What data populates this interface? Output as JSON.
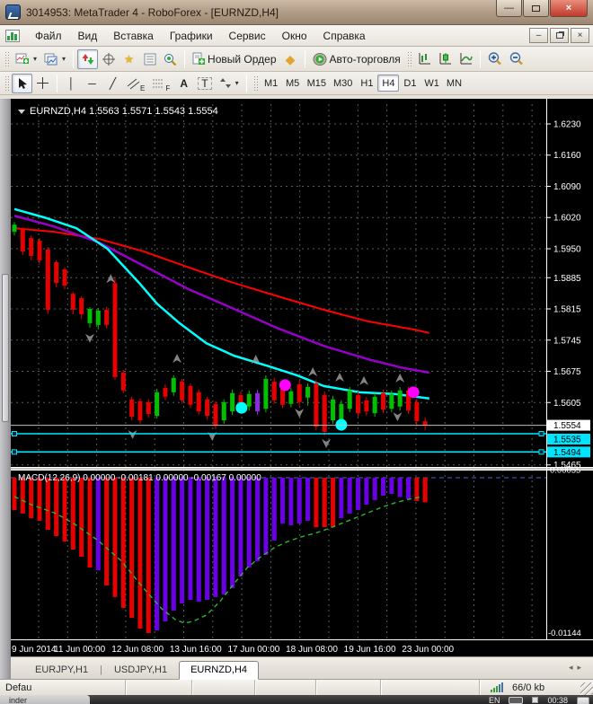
{
  "window": {
    "title": "3014953: MetaTrader 4 - RoboForex - [EURNZD,H4]"
  },
  "menu": {
    "items": [
      "Файл",
      "Вид",
      "Вставка",
      "Графики",
      "Сервис",
      "Окно",
      "Справка"
    ]
  },
  "toolbar": {
    "new_order": "Новый Ордер",
    "auto_trading": "Авто-торговля",
    "text_tool": "A",
    "label_tool": "T",
    "channel_suffix": "E",
    "fibo_suffix": "F",
    "timeframes": [
      "M1",
      "M5",
      "M15",
      "M30",
      "H1",
      "H4",
      "D1",
      "W1",
      "MN"
    ],
    "active_timeframe": "H4"
  },
  "chart": {
    "header_symbol": "EURNZD,H4",
    "header_ohlc": "1.5563 1.5571 1.5543 1.5554",
    "macd_header": "MACD(12,26,9) 0.00000 -0.00181 0.00000 -0.00167 0.00000"
  },
  "chart_data": {
    "type": "candlestick+macd",
    "symbol": "EURNZD",
    "timeframe": "H4",
    "price_axis": {
      "labels": [
        1.623,
        1.616,
        1.609,
        1.602,
        1.595,
        1.5885,
        1.5815,
        1.5745,
        1.5675,
        1.5605,
        1.5465
      ],
      "grid_levels": [
        1.623,
        1.616,
        1.609,
        1.602,
        1.595,
        1.5885,
        1.5815,
        1.5745,
        1.5675,
        1.5605,
        1.5535,
        1.5465
      ],
      "current_price": 1.5554,
      "line_levels": [
        1.5535,
        1.5494
      ]
    },
    "time_axis": {
      "labels": [
        "9 Jun 2014",
        "11 Jun 00:00",
        "12 Jun 08:00",
        "13 Jun 16:00",
        "17 Jun 00:00",
        "18 Jun 08:00",
        "19 Jun 16:00",
        "23 Jun 00:00"
      ]
    },
    "candles": [
      [
        1.5988,
        1.601,
        1.598,
        1.6004,
        "g"
      ],
      [
        1.5994,
        1.5998,
        1.5936,
        1.5944,
        "r"
      ],
      [
        1.5974,
        1.598,
        1.5924,
        1.5934,
        "r"
      ],
      [
        1.5968,
        1.5974,
        1.5914,
        1.5924,
        "r"
      ],
      [
        1.5948,
        1.5954,
        1.5803,
        1.5813,
        "r"
      ],
      [
        1.592,
        1.5924,
        1.5863,
        1.5873,
        "r"
      ],
      [
        1.5904,
        1.5908,
        1.5859,
        1.5867,
        "r"
      ],
      [
        1.5849,
        1.5853,
        1.5803,
        1.5813,
        "r"
      ],
      [
        1.5839,
        1.5843,
        1.5793,
        1.5803,
        "r"
      ],
      [
        1.5783,
        1.5819,
        1.5773,
        1.5815,
        "g"
      ],
      [
        1.5779,
        1.5817,
        1.5769,
        1.5811,
        "g"
      ],
      [
        1.5813,
        1.5819,
        1.5771,
        1.5779,
        "r"
      ],
      [
        1.5873,
        1.5887,
        1.5656,
        1.5662,
        "r"
      ],
      [
        1.5672,
        1.5678,
        1.5626,
        1.5632,
        "r"
      ],
      [
        1.5612,
        1.5618,
        1.5565,
        1.5573,
        "r"
      ],
      [
        1.5608,
        1.5614,
        1.5557,
        1.5565,
        "r"
      ],
      [
        1.5606,
        1.5612,
        1.5571,
        1.5579,
        "r"
      ],
      [
        1.5575,
        1.5636,
        1.5569,
        1.5628,
        "g"
      ],
      [
        1.5638,
        1.5646,
        1.561,
        1.5618,
        "r"
      ],
      [
        1.5628,
        1.5666,
        1.562,
        1.566,
        "g"
      ],
      [
        1.5652,
        1.5658,
        1.5602,
        1.561,
        "r"
      ],
      [
        1.5642,
        1.5648,
        1.5592,
        1.56,
        "r"
      ],
      [
        1.5628,
        1.5634,
        1.5577,
        1.5585,
        "r"
      ],
      [
        1.5612,
        1.5618,
        1.5567,
        1.5575,
        "r"
      ],
      [
        1.5602,
        1.5608,
        1.5545,
        1.5553,
        "r"
      ],
      [
        1.5565,
        1.5612,
        1.5557,
        1.5606,
        "g"
      ],
      [
        1.5585,
        1.5634,
        1.5577,
        1.5626,
        "g"
      ],
      [
        1.5622,
        1.563,
        1.5594,
        1.5602,
        "r"
      ],
      [
        1.5596,
        1.5632,
        1.5587,
        1.5624,
        "g"
      ],
      [
        1.5626,
        1.5634,
        1.5577,
        1.5585,
        "v"
      ],
      [
        1.5591,
        1.5666,
        1.5583,
        1.5658,
        "g"
      ],
      [
        1.5652,
        1.566,
        1.5602,
        1.561,
        "r"
      ],
      [
        1.5642,
        1.565,
        1.5592,
        1.56,
        "r"
      ],
      [
        1.5602,
        1.5638,
        1.5594,
        1.563,
        "g"
      ],
      [
        1.5646,
        1.5654,
        1.5598,
        1.5606,
        "r"
      ],
      [
        1.5616,
        1.5648,
        1.5598,
        1.564,
        "g"
      ],
      [
        1.5648,
        1.5656,
        1.5543,
        1.5551,
        "r"
      ],
      [
        1.5622,
        1.563,
        1.5531,
        1.5539,
        "r"
      ],
      [
        1.5565,
        1.562,
        1.5557,
        1.5612,
        "g"
      ],
      [
        1.5553,
        1.561,
        1.5545,
        1.5602,
        "g"
      ],
      [
        1.5591,
        1.564,
        1.5583,
        1.5632,
        "g"
      ],
      [
        1.5622,
        1.563,
        1.5573,
        1.5581,
        "r"
      ],
      [
        1.561,
        1.5618,
        1.5575,
        1.5585,
        "r"
      ],
      [
        1.5581,
        1.5626,
        1.5573,
        1.5618,
        "g"
      ],
      [
        1.5626,
        1.5634,
        1.5581,
        1.5589,
        "r"
      ],
      [
        1.5591,
        1.5632,
        1.5583,
        1.5624,
        "g"
      ],
      [
        1.5596,
        1.564,
        1.5587,
        1.5632,
        "g"
      ],
      [
        1.5632,
        1.564,
        1.5579,
        1.5587,
        "r"
      ],
      [
        1.5606,
        1.5614,
        1.5551,
        1.5563,
        "r"
      ],
      [
        1.5563,
        1.5571,
        1.5543,
        1.5554,
        "r"
      ]
    ],
    "overlays": {
      "ma_red": [
        [
          0,
          1.5996
        ],
        [
          4.7,
          1.5988
        ],
        [
          10.1,
          1.5972
        ],
        [
          15.4,
          1.5944
        ],
        [
          20.8,
          1.5908
        ],
        [
          26.2,
          1.5873
        ],
        [
          31.5,
          1.5843
        ],
        [
          36.9,
          1.5813
        ],
        [
          42.2,
          1.5787
        ],
        [
          47.6,
          1.5769
        ],
        [
          49.5,
          1.5761
        ]
      ],
      "ma_purple": [
        [
          0,
          1.6024
        ],
        [
          4.7,
          1.6
        ],
        [
          10.1,
          1.5964
        ],
        [
          15.4,
          1.5912
        ],
        [
          20.8,
          1.5859
        ],
        [
          26.2,
          1.5815
        ],
        [
          31.5,
          1.5771
        ],
        [
          36.9,
          1.5732
        ],
        [
          42.2,
          1.5702
        ],
        [
          46.5,
          1.5682
        ],
        [
          49.5,
          1.5672
        ]
      ],
      "ma_cyan": [
        [
          0,
          1.6039
        ],
        [
          3.6,
          1.602
        ],
        [
          7.4,
          1.5996
        ],
        [
          11.1,
          1.595
        ],
        [
          14.9,
          1.5873
        ],
        [
          17,
          1.5827
        ],
        [
          19.7,
          1.5783
        ],
        [
          22.9,
          1.5738
        ],
        [
          26.2,
          1.571
        ],
        [
          30.4,
          1.5686
        ],
        [
          33.7,
          1.5666
        ],
        [
          36.9,
          1.5642
        ],
        [
          41.2,
          1.5628
        ],
        [
          45.4,
          1.5624
        ],
        [
          49.5,
          1.5614
        ]
      ],
      "arrows_up": [
        [
          11.5,
          1.5879
        ],
        [
          19.4,
          1.57
        ],
        [
          28.8,
          1.5698
        ],
        [
          35.6,
          1.567
        ],
        [
          38.8,
          1.5658
        ],
        [
          41.7,
          1.565
        ],
        [
          46,
          1.5656
        ]
      ],
      "arrows_down": [
        [
          9,
          1.5753
        ],
        [
          14.1,
          1.5537
        ],
        [
          23.6,
          1.5533
        ],
        [
          34,
          1.5585
        ],
        [
          37.2,
          1.5517
        ],
        [
          45.7,
          1.5577
        ]
      ],
      "dots_cyan": [
        [
          27.1,
          1.5593
        ],
        [
          39,
          1.5555
        ]
      ],
      "dots_magenta": [
        [
          32.3,
          1.5644
        ],
        [
          47.6,
          1.5628
        ]
      ]
    },
    "macd": {
      "params": "12,26,9",
      "scale_top": 0.00055,
      "scale_bottom": -0.01144,
      "values": [
        -0.00238,
        -0.00264,
        -0.00298,
        -0.00317,
        -0.00384,
        -0.0043,
        -0.0047,
        -0.00529,
        -0.00582,
        -0.00661,
        -0.00681,
        -0.00794,
        -0.00879,
        -0.00959,
        -0.01032,
        -0.01111,
        -0.01144,
        -0.01124,
        -0.01058,
        -0.00979,
        -0.00926,
        -0.00899,
        -0.00913,
        -0.00899,
        -0.00879,
        -0.0086,
        -0.00813,
        -0.00727,
        -0.00661,
        -0.00615,
        -0.00569,
        -0.00463,
        -0.00337,
        -0.0035,
        -0.00337,
        -0.00317,
        -0.00364,
        -0.00364,
        -0.00364,
        -0.00298,
        -0.00264,
        -0.00238,
        -0.00198,
        -0.00165,
        -0.00132,
        -0.00119,
        -0.00142,
        -0.00155,
        -0.00172,
        -0.00181
      ],
      "colors": [
        "r",
        "r",
        "r",
        "r",
        "r",
        "r",
        "r",
        "r",
        "r",
        "r",
        "v",
        "r",
        "r",
        "r",
        "r",
        "r",
        "r",
        "v",
        "v",
        "v",
        "v",
        "v",
        "v",
        "v",
        "v",
        "v",
        "v",
        "v",
        "v",
        "v",
        "v",
        "v",
        "v",
        "v",
        "v",
        "v",
        "r",
        "r",
        "r",
        "v",
        "v",
        "v",
        "v",
        "v",
        "v",
        "v",
        "v",
        "v",
        "r",
        "r"
      ],
      "signal": [
        [
          0,
          -0.00139
        ],
        [
          2,
          -0.00198
        ],
        [
          5,
          -0.00264
        ],
        [
          7.4,
          -0.0035
        ],
        [
          10,
          -0.00463
        ],
        [
          12.8,
          -0.00615
        ],
        [
          15.4,
          -0.00813
        ],
        [
          17.6,
          -0.00966
        ],
        [
          19.2,
          -0.01045
        ],
        [
          20.3,
          -0.01071
        ],
        [
          21.3,
          -0.01058
        ],
        [
          22.9,
          -0.01012
        ],
        [
          24.5,
          -0.00913
        ],
        [
          26.2,
          -0.0078
        ],
        [
          27.8,
          -0.00661
        ],
        [
          29.4,
          -0.00582
        ],
        [
          31,
          -0.00516
        ],
        [
          32.6,
          -0.0047
        ],
        [
          34.2,
          -0.00436
        ],
        [
          35.8,
          -0.0041
        ],
        [
          37.4,
          -0.00377
        ],
        [
          39,
          -0.00337
        ],
        [
          40.6,
          -0.00298
        ],
        [
          42.2,
          -0.00258
        ],
        [
          43.8,
          -0.00218
        ],
        [
          45.4,
          -0.00185
        ],
        [
          47,
          -0.00159
        ],
        [
          48.7,
          -0.00139
        ]
      ]
    },
    "colors": {
      "bull": "#00c000",
      "bear": "#e60000",
      "violet_candle": "#8a2be2",
      "ma_red": "#ff0000",
      "ma_purple": "#9600c8",
      "ma_cyan": "#00ffff",
      "macd_red": "#e60000",
      "macd_violet": "#6a00e6",
      "signal": "#2db52d",
      "hline": "#00e5ff",
      "current_line": "#c0c0c0",
      "zero_line": "#5560dd",
      "grid": "#4d5f5f",
      "bg": "#000000",
      "axis_text": "#ffffff",
      "arrow": "#9a9a9a"
    },
    "layout_hints": {
      "grid": true,
      "legend": false,
      "panes": [
        "price",
        "macd"
      ]
    }
  },
  "tabs": {
    "items": [
      "EURJPY,H1",
      "USDJPY,H1",
      "EURNZD,H4"
    ],
    "active": "EURNZD,H4",
    "active_index": 2
  },
  "statusbar": {
    "profile": "Defau",
    "traffic": "66/0 kb"
  },
  "taskbar": {
    "window_fragment": "inder",
    "lang": "EN",
    "time": "00:38"
  }
}
